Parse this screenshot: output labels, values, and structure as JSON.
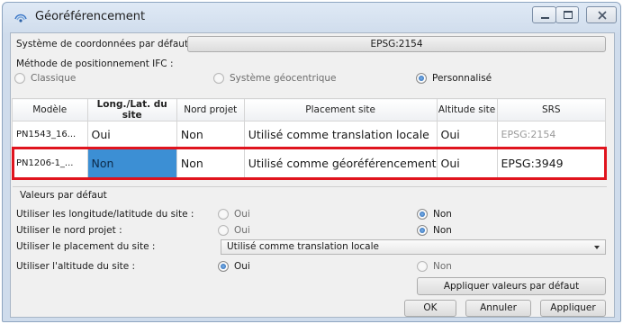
{
  "window": {
    "title": "Géoréférencement"
  },
  "default_crs": {
    "label": "Système de coordonnées par défaut :",
    "value": "EPSG:2154"
  },
  "ifc_method": {
    "label": "Méthode de positionnement IFC :",
    "options": [
      {
        "label": "Classique",
        "selected": false
      },
      {
        "label": "Système géocentrique",
        "selected": false
      },
      {
        "label": "Personnalisé",
        "selected": true
      }
    ]
  },
  "table": {
    "columns": [
      "Modèle",
      "Long./Lat. du site",
      "Nord projet",
      "Placement site",
      "Altitude site",
      "SRS"
    ],
    "rows": [
      [
        "PN1543_16...",
        "Oui",
        "Non",
        "Utilisé comme translation locale",
        "Oui",
        "EPSG:2154"
      ],
      [
        "PN1206-1_...",
        "Non",
        "Non",
        "Utilisé comme géoréférencement",
        "Oui",
        "EPSG:3949"
      ]
    ]
  },
  "defaults": {
    "section_title": "Valeurs par défaut",
    "rows": [
      {
        "label": "Utiliser les longitude/latitude du site :",
        "oui": "Oui",
        "non": "Non",
        "selected": "non"
      },
      {
        "label": "Utiliser le nord projet :",
        "oui": "Oui",
        "non": "Non",
        "selected": "non"
      },
      {
        "label": "Utiliser le placement du site :",
        "value": "Utilisé comme translation locale"
      },
      {
        "label": "Utiliser l'altitude du site :",
        "oui": "Oui",
        "non": "Non",
        "selected": "oui"
      }
    ],
    "apply_defaults_label": "Appliquer valeurs par défaut"
  },
  "buttons": {
    "ok": "OK",
    "cancel": "Annuler",
    "apply": "Appliquer"
  },
  "colors": {
    "selection": "#3c8fd4",
    "highlight": "#e0141e",
    "accent": "#1f5fae"
  }
}
